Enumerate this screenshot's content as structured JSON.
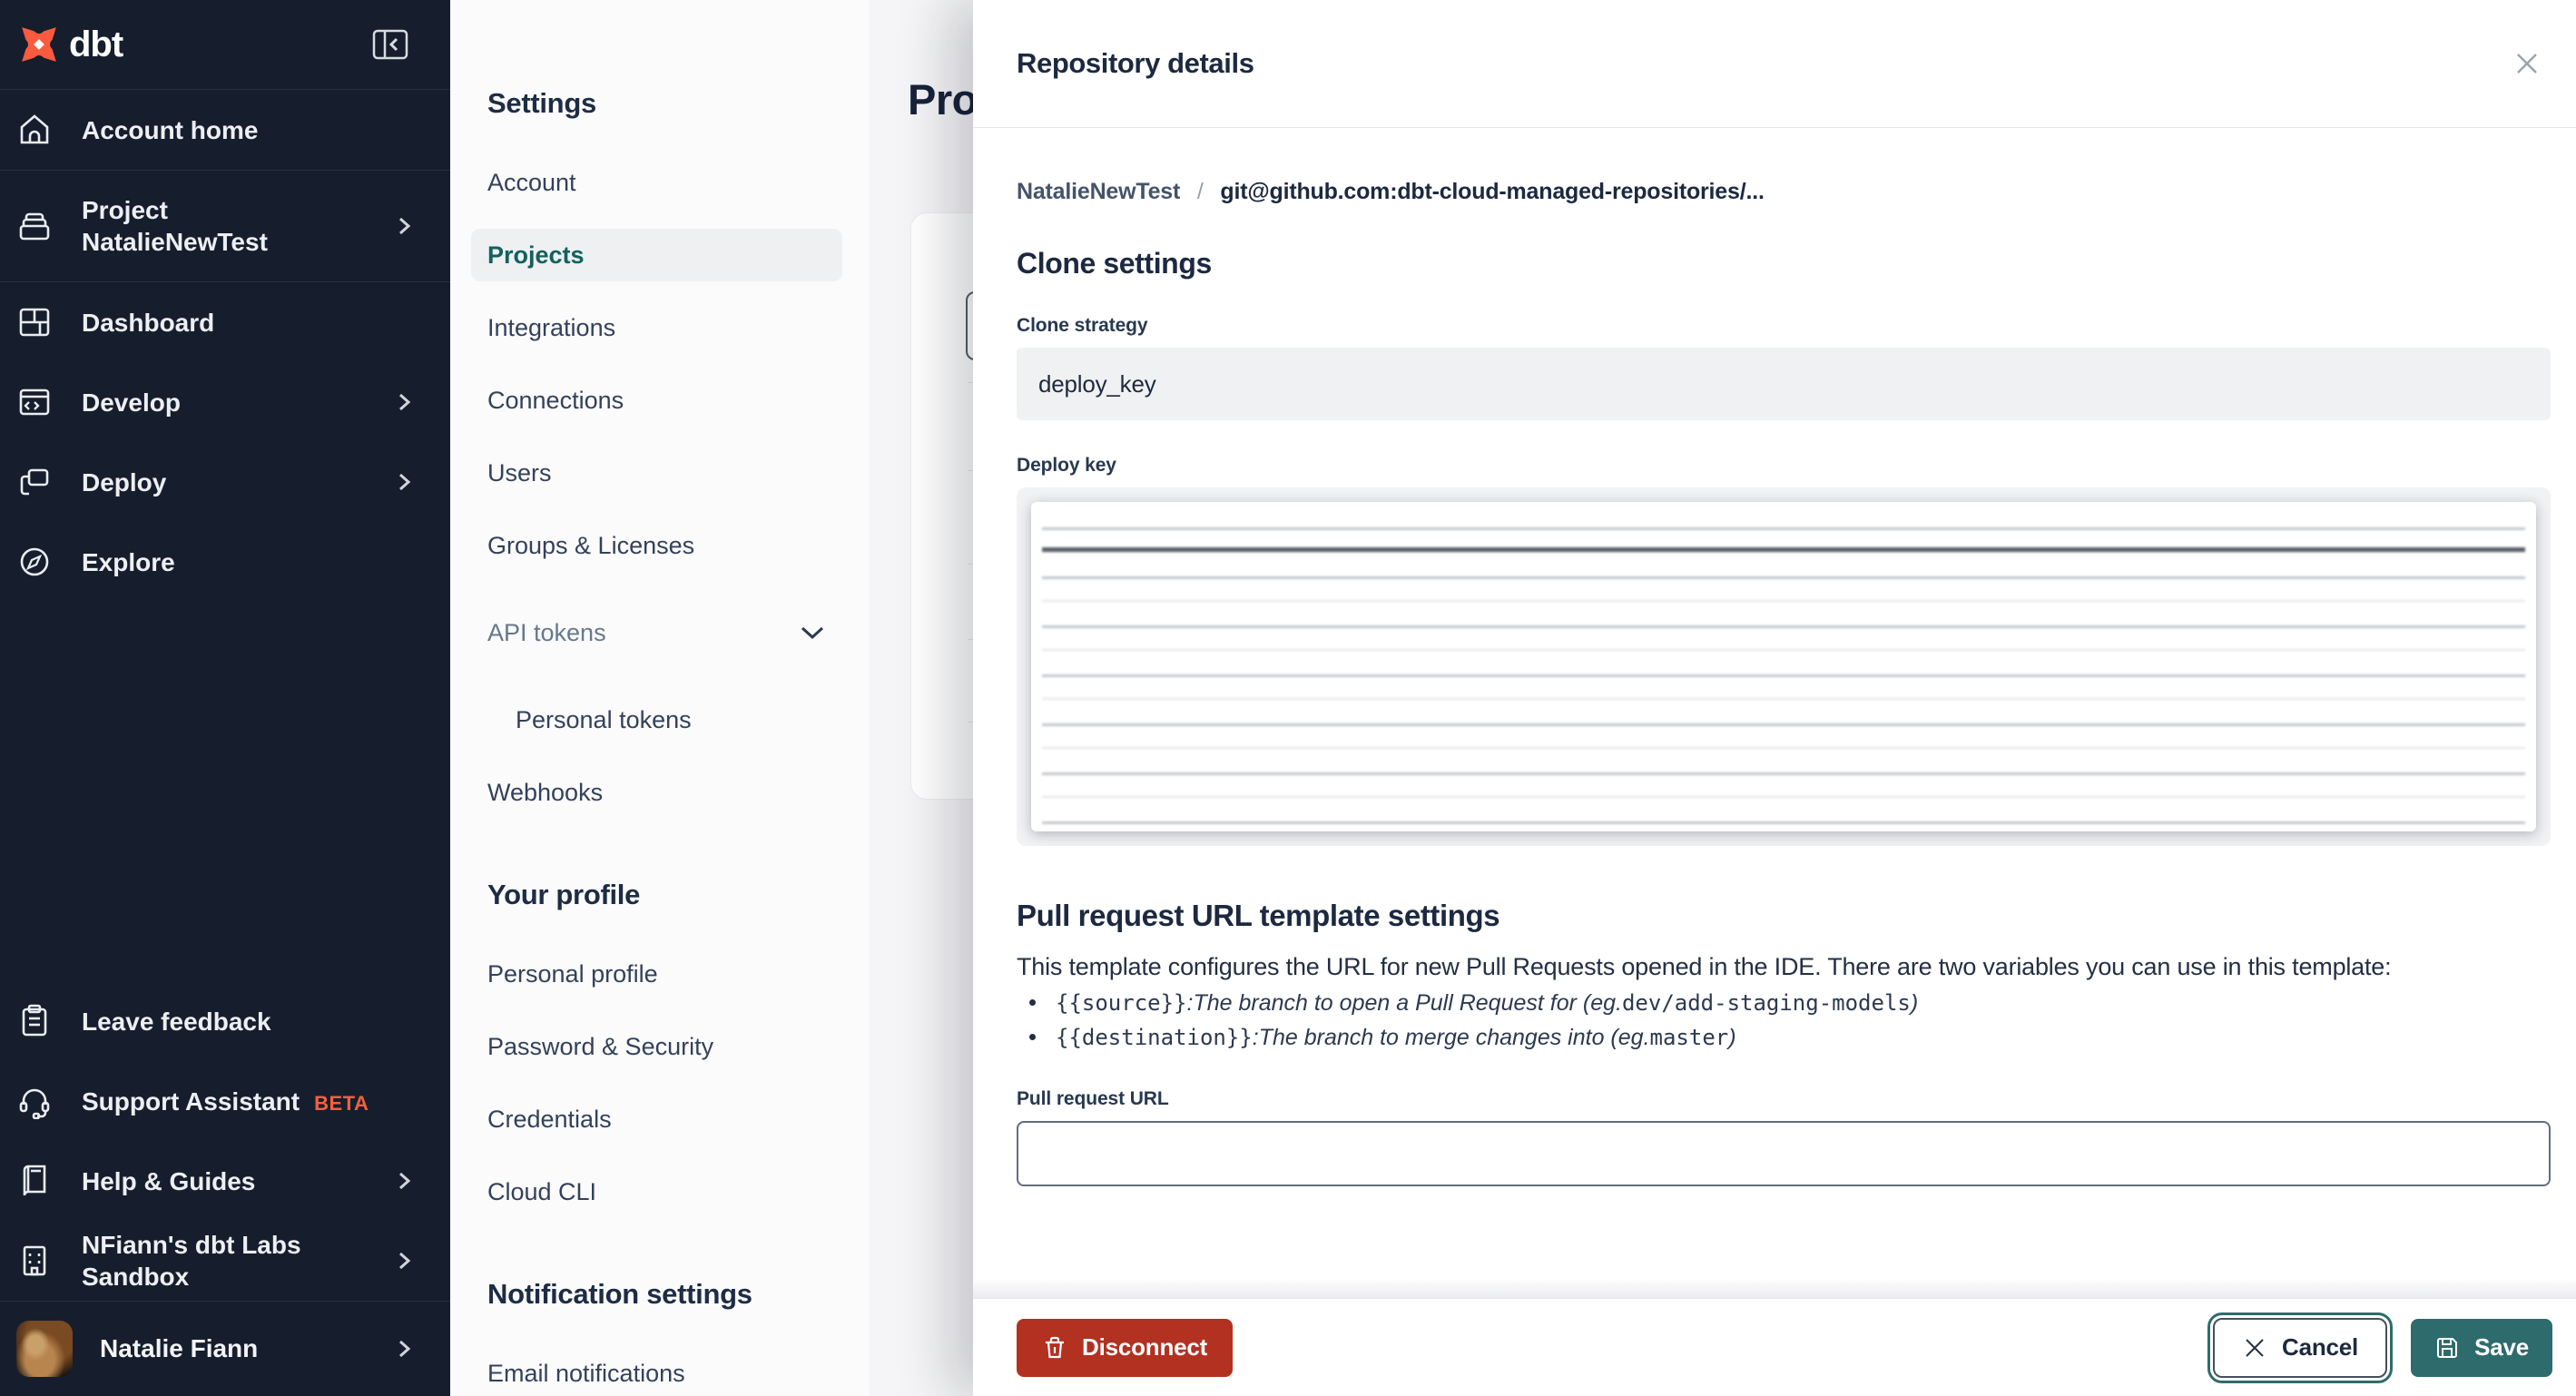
{
  "colors": {
    "sidebar_bg": "#161e2d",
    "brand_orange": "#fa5b3e",
    "beta_orange": "#f4603f",
    "accent_teal": "#2e6b6c",
    "active_teal_text": "#15605e",
    "danger_red": "#b23120",
    "text_dark": "#1c2940"
  },
  "sidebar": {
    "brand": "dbt",
    "items": [
      {
        "label": "Account home"
      },
      {
        "line1": "Project",
        "line2": "NatalieNewTest"
      },
      {
        "label": "Dashboard"
      },
      {
        "label": "Develop"
      },
      {
        "label": "Deploy"
      },
      {
        "label": "Explore"
      }
    ],
    "footer_items": [
      {
        "label": "Leave feedback"
      },
      {
        "label": "Support Assistant",
        "badge": "BETA"
      },
      {
        "label": "Help & Guides"
      },
      {
        "label": "NFiann's dbt Labs Sandbox"
      }
    ],
    "user": {
      "name": "Natalie Fiann"
    }
  },
  "settings_nav": {
    "heading": "Settings",
    "items": [
      {
        "label": "Account"
      },
      {
        "label": "Projects"
      },
      {
        "label": "Integrations"
      },
      {
        "label": "Connections"
      },
      {
        "label": "Users"
      },
      {
        "label": "Groups & Licenses"
      },
      {
        "label": "API tokens"
      },
      {
        "label": "Personal tokens"
      },
      {
        "label": "Webhooks"
      }
    ],
    "profile_heading": "Your profile",
    "profile_items": [
      "Personal profile",
      "Password & Security",
      "Credentials",
      "Cloud CLI"
    ],
    "notifications_heading": "Notification settings",
    "notification_items": [
      "Email notifications"
    ]
  },
  "page": {
    "title": "Projects"
  },
  "drawer": {
    "title": "Repository details",
    "breadcrumb": {
      "project": "NatalieNewTest",
      "separator": "/",
      "repo": "git@github.com:dbt-cloud-managed-repositories/..."
    },
    "clone": {
      "heading": "Clone settings",
      "strategy_label": "Clone strategy",
      "strategy_value": "deploy_key",
      "deploy_key_label": "Deploy key"
    },
    "pr_template": {
      "heading": "Pull request URL template settings",
      "description": "This template configures the URL for new Pull Requests opened in the IDE. There are two variables you can use in this template:",
      "bullets": [
        {
          "code": "{{source}}",
          "sep": ": ",
          "desc": "The branch to open a Pull Request for (eg. ",
          "example": "dev/add-staging-models",
          "close": ")"
        },
        {
          "code": "{{destination}}",
          "sep": ": ",
          "desc": "The branch to merge changes into (eg. ",
          "example": "master",
          "close": ")"
        }
      ],
      "url_label": "Pull request URL",
      "url_value": ""
    },
    "footer": {
      "disconnect": "Disconnect",
      "cancel": "Cancel",
      "save": "Save"
    }
  }
}
